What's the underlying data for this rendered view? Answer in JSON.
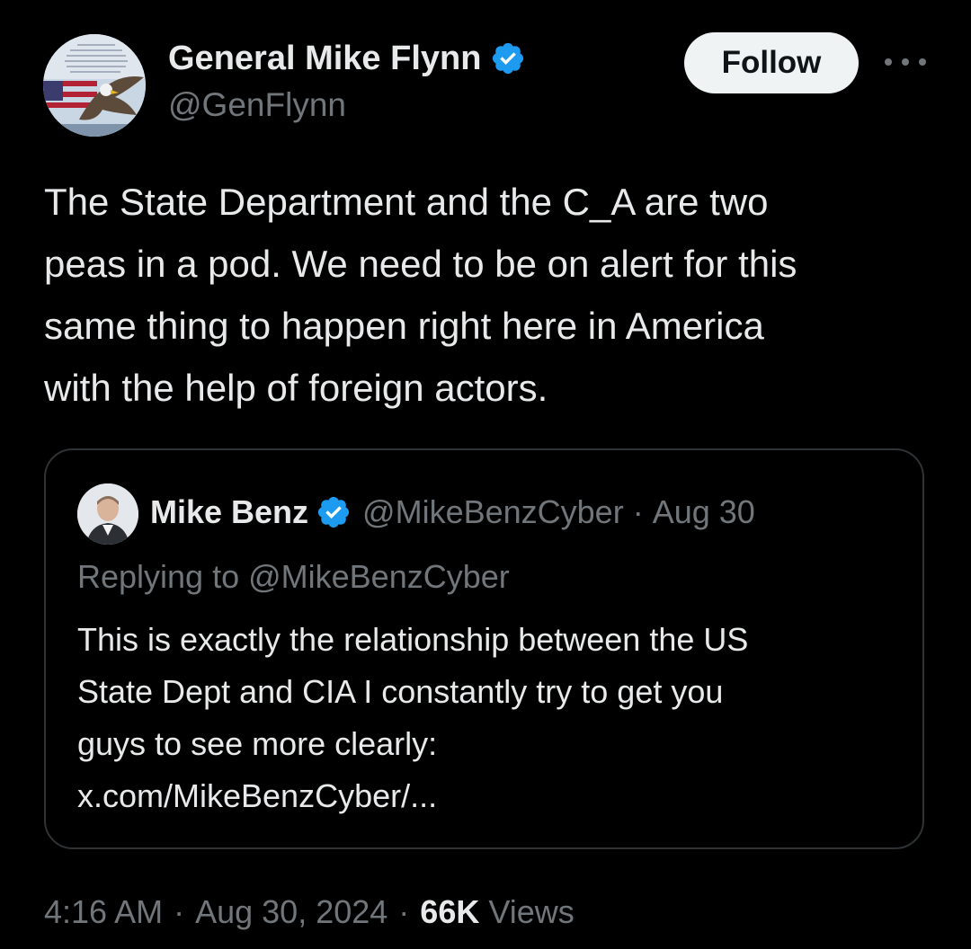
{
  "tweet": {
    "author": {
      "name": "General Mike Flynn",
      "handle": "@GenFlynn",
      "verified": true
    },
    "follow_label": "Follow",
    "more_icon": "more-horizontal-icon",
    "text_lines": [
      "The State Department and the C_A are two",
      "peas in a pod. We need to be on alert for this",
      "same thing to happen right here in America",
      "with the help of foreign actors."
    ],
    "quote": {
      "author": {
        "name": "Mike Benz",
        "handle": "@MikeBenzCyber",
        "verified": true
      },
      "separator": "·",
      "date": "Aug 30",
      "replying_to": "Replying to @MikeBenzCyber",
      "text_lines": [
        "This is exactly the relationship between the US",
        "State Dept and CIA I constantly try to get you",
        "guys to see more clearly:",
        "x.com/MikeBenzCyber/..."
      ]
    },
    "meta": {
      "time": "4:16 AM",
      "separator": "·",
      "date": "Aug 30, 2024",
      "views_count": "66K",
      "views_label": "Views"
    }
  },
  "colors": {
    "background": "#000000",
    "text_primary": "#e7e9ea",
    "text_secondary": "#71767b",
    "verified_blue": "#1d9bf0",
    "border": "#2f3336",
    "follow_bg": "#eff3f4"
  }
}
